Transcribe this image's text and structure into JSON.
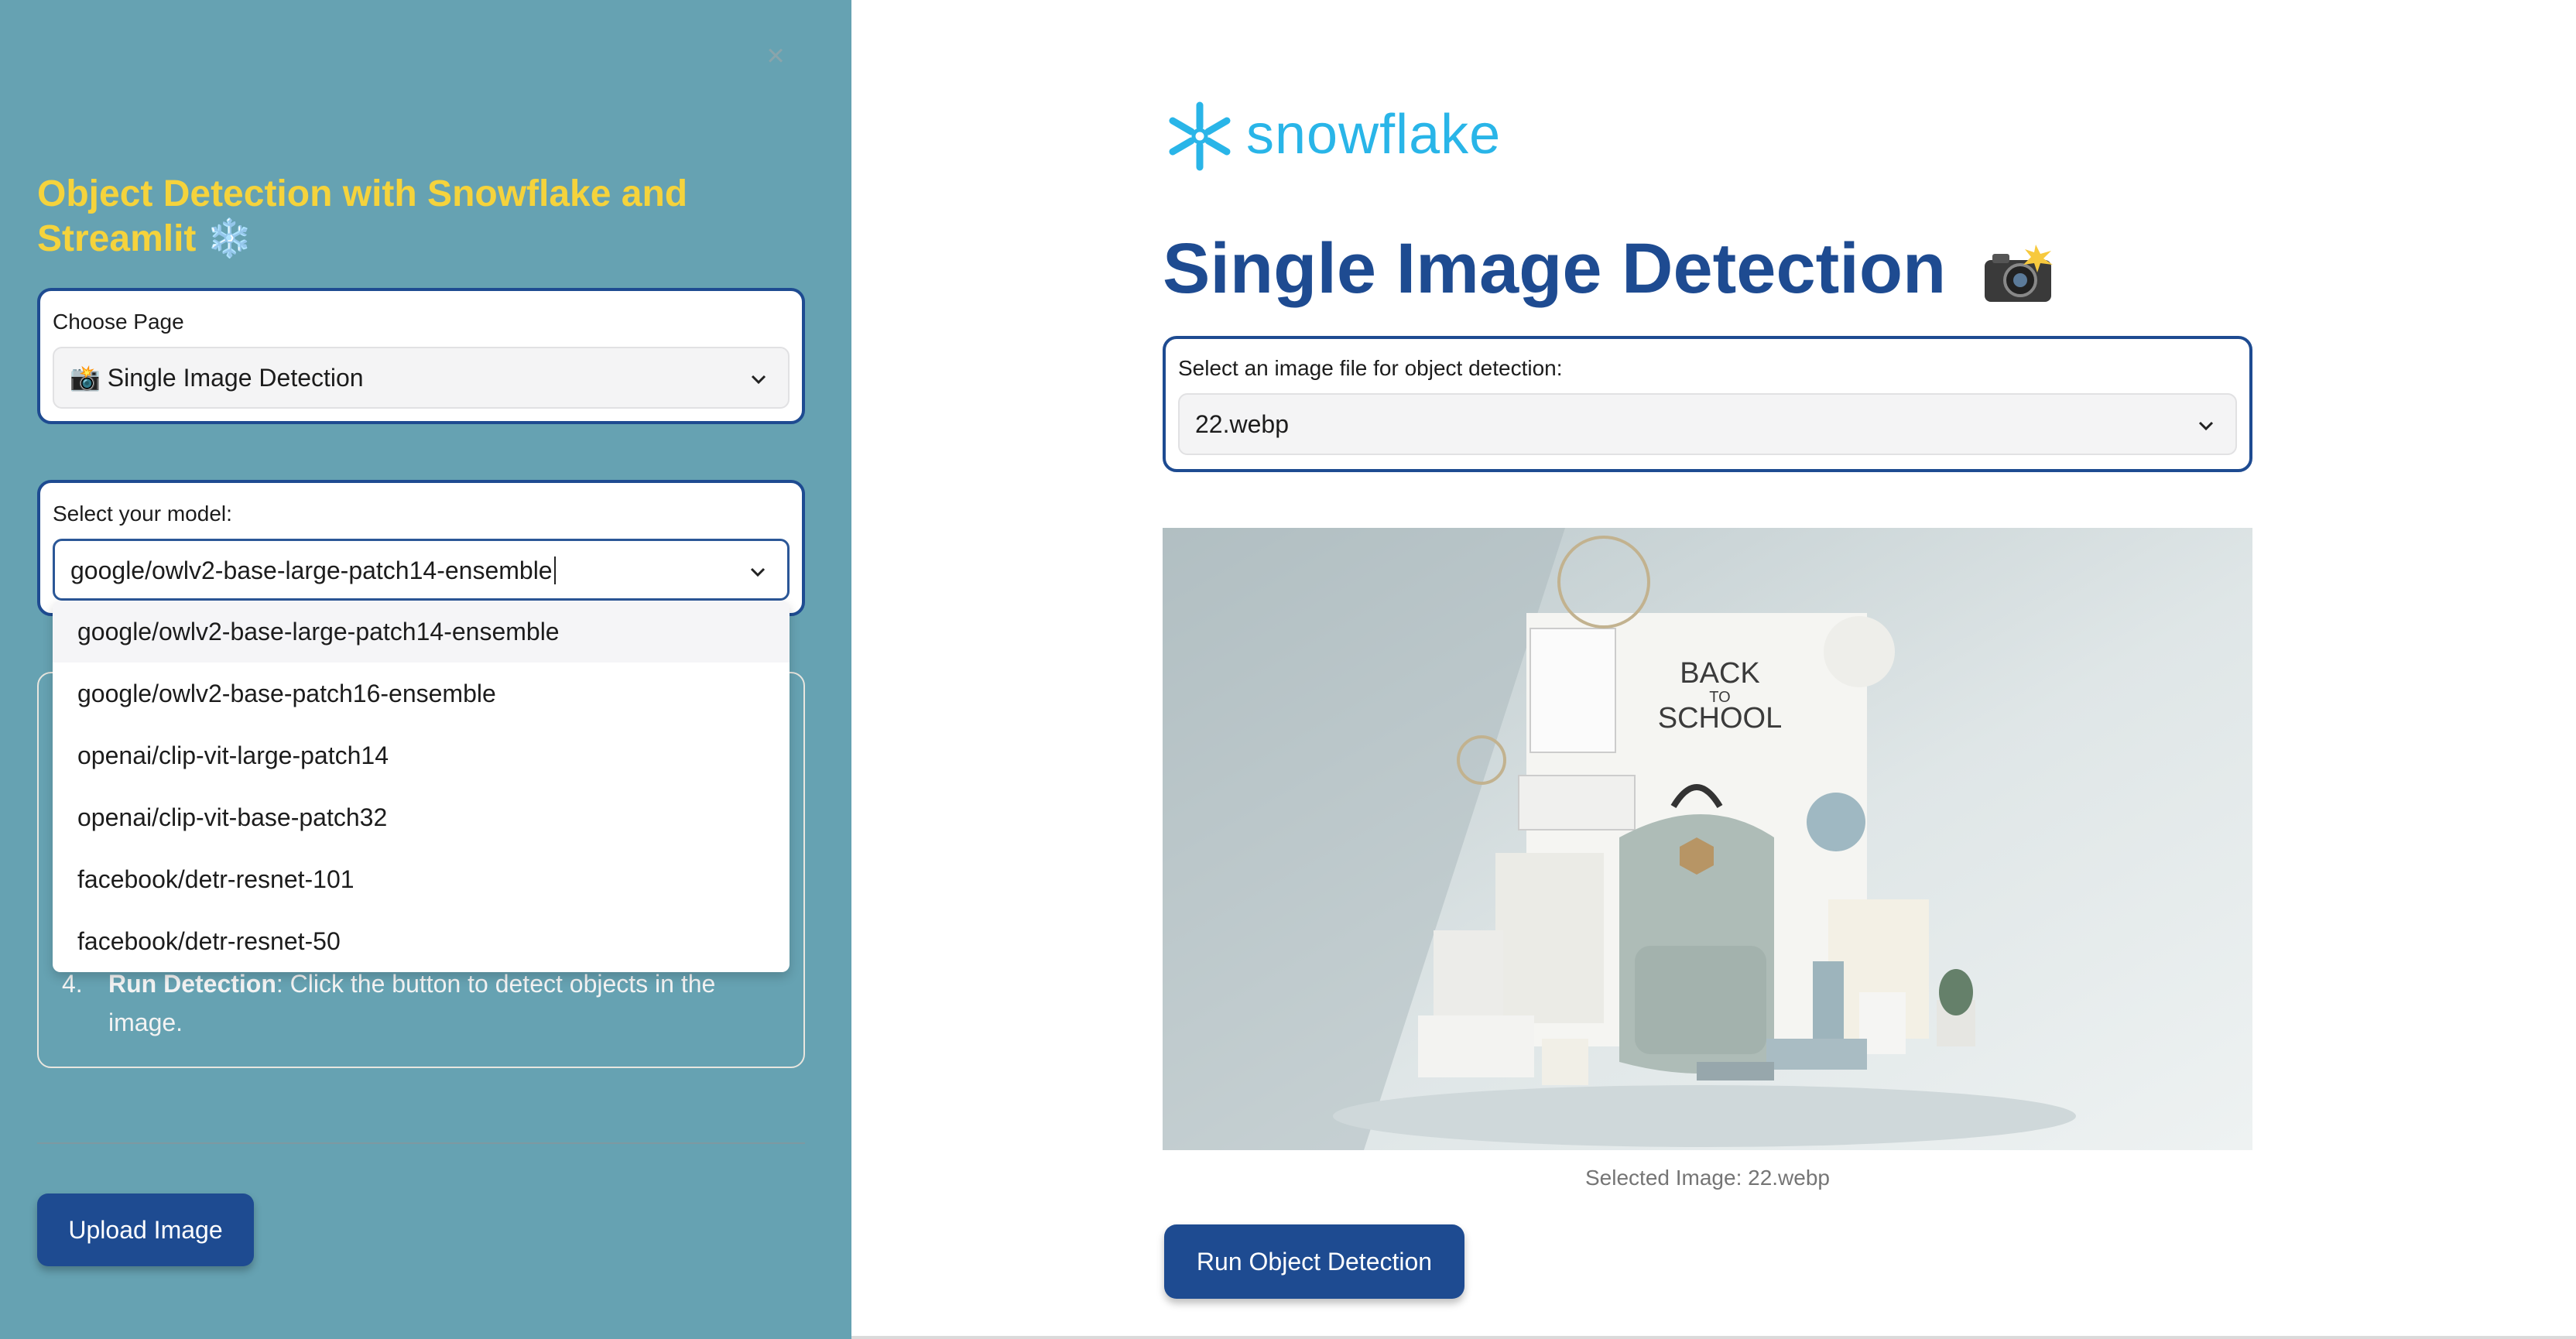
{
  "sidebar": {
    "title": "Object Detection with Snowflake and Streamlit ❄️",
    "page_select": {
      "label": "Choose Page",
      "value": "📸 Single Image Detection"
    },
    "model_select": {
      "label": "Select your model:",
      "value": "google/owlv2-base-large-patch14-ensemble",
      "options": [
        "google/owlv2-base-large-patch14-ensemble",
        "google/owlv2-base-patch16-ensemble",
        "openai/clip-vit-large-patch14",
        "openai/clip-vit-base-patch32",
        "facebook/detr-resnet-101",
        "facebook/detr-resnet-50"
      ]
    },
    "instructions": {
      "step_number": "4.",
      "step_title": "Run Detection",
      "step_text": ": Click the button to detect objects in the image."
    },
    "upload_button": "Upload Image"
  },
  "main": {
    "logo_text": "snowflake",
    "title": "Single Image Detection",
    "file_select": {
      "label": "Select an image file for object detection:",
      "value": "22.webp"
    },
    "image": {
      "heading_line1": "BACK",
      "heading_line2": "TO",
      "heading_line3": "SCHOOL",
      "caption": "Selected Image: 22.webp"
    },
    "run_button": "Run Object Detection"
  },
  "colors": {
    "sidebar_bg": "#66a2b2",
    "accent": "#1e4b91",
    "sidebar_title": "#f5d33c",
    "logo_blue": "#29b5e8"
  }
}
